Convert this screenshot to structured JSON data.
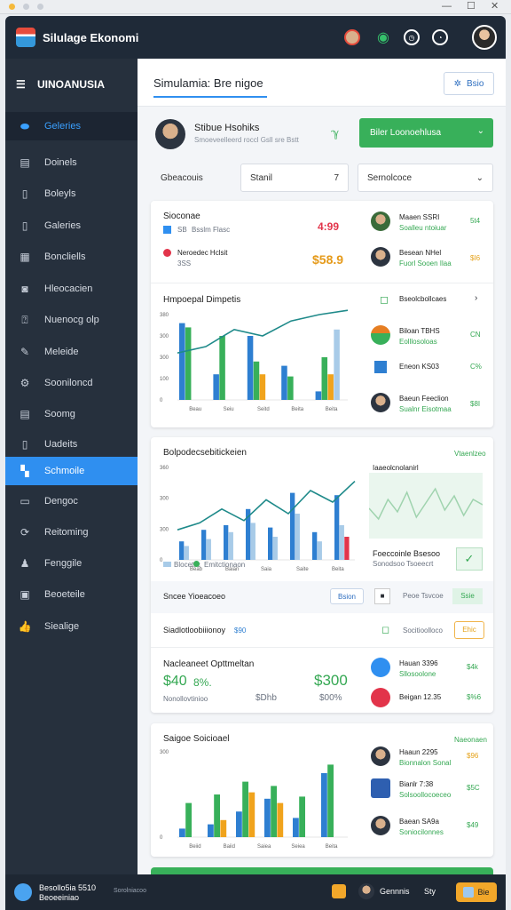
{
  "app": {
    "title": "Silulage Ekonomi"
  },
  "sidebar": {
    "header": "UINOANUSIA",
    "items": [
      {
        "label": "Geleries",
        "icon": "pill-icon"
      },
      {
        "label": "Doinels",
        "icon": "doc-icon"
      },
      {
        "label": "Boleyls",
        "icon": "bookmark-icon"
      },
      {
        "label": "Galeries",
        "icon": "bookmark-icon"
      },
      {
        "label": "Boncliells",
        "icon": "grid-icon"
      },
      {
        "label": "Hleocacien",
        "icon": "camera-icon"
      },
      {
        "label": "Nuenocg olp",
        "icon": "help-icon"
      },
      {
        "label": "Meleide",
        "icon": "pin-icon"
      },
      {
        "label": "Sooniloncd",
        "icon": "settings-icon"
      },
      {
        "label": "Soomg",
        "icon": "sheet-icon"
      },
      {
        "label": "Uadeits",
        "icon": "file-icon"
      },
      {
        "label": "Schmoile",
        "icon": "cart-icon"
      },
      {
        "label": "Dengoc",
        "icon": "window-icon"
      },
      {
        "label": "Reitoming",
        "icon": "refresh-icon"
      },
      {
        "label": "Fenggile",
        "icon": "person-icon"
      },
      {
        "label": "Beoeteile",
        "icon": "wallet-icon"
      },
      {
        "label": "Siealige",
        "icon": "thumbs-up-icon"
      }
    ]
  },
  "main": {
    "title": "Simulamia: Bre nigoe",
    "top_button": "Bsio",
    "profile": {
      "name": "Stibue Hsohiks",
      "subtitle": "Smoeveelleerd roccl Gsll sre Bstt"
    },
    "green_button": "Biler Loonoehlusa",
    "field1": "Gbeacouis",
    "field2": "Stanil",
    "field2_value": "7",
    "field3": "Sernolcoce"
  },
  "card1": {
    "title": "Sioconae",
    "row1_label": "Bsslm Flasc",
    "row1_prefix": "SB",
    "row1_value": "4:99",
    "row2_label": "Neroedec Hclsit",
    "row2_prefix": "3SS",
    "row2_value": "$58.9",
    "chart_title": "Hmpoepal Dimpetis",
    "people": [
      {
        "name": "Maaen SSRI",
        "sub": "Soalleu ntoiuar",
        "value": "5t4",
        "color": "#35a853"
      },
      {
        "name": "Besean NHel",
        "sub": "Fuorl Sooen Ilaa",
        "value": "$I6",
        "color": "#e5a21a"
      }
    ],
    "side_title": "Bseolcbollcaes",
    "side_items": [
      {
        "name": "Biloan TBHS",
        "sub": "Eolllosoloas",
        "value": "CN"
      },
      {
        "name": "Eneon KS03",
        "sub": "",
        "value": "C%"
      },
      {
        "name": "Baeun Feeclion",
        "sub": "Sualnr Eisotmaa",
        "value": "$8I"
      }
    ]
  },
  "card2": {
    "title": "Bolpodecsebitickeien",
    "right_label": "Vtaenlzeo",
    "legend1": "Blocetiic",
    "legend2": "Emitctionaon",
    "side_chart_title": "Iaaeolcnolanirl",
    "caption": "Foeccoinle Bsesoo",
    "caption_sub": "Sonodsoo Tsoeecrt",
    "strip_label": "Sncee Yioeacoeo",
    "strip_btn1": "Bsion",
    "strip_btn2": "Peoe Tsvcoe",
    "strip_btn3": "Ssie",
    "row_title": "Siadlotloobiiionoy",
    "row_tag": "$90",
    "row_side": "Socitioolloco",
    "row_btn": "Ehic",
    "metric_title": "Nacleaneet Opttmeltan",
    "metric_val1": "$40",
    "metric_val1b": "8%.",
    "metric_val2": "$300",
    "metric_sub": "Nonollovtinioo",
    "metric_sub2": "$Dhb",
    "metric_sub3": "$00%",
    "people": [
      {
        "name": "Hauan 3396",
        "sub": "Sllosoolone",
        "value": "$4k",
        "color": "#35a853"
      },
      {
        "name": "Beigan 12.35",
        "sub": "",
        "value": "$%6",
        "color": "#35a853"
      }
    ]
  },
  "card3": {
    "title": "Saigoe Soicioael",
    "right_label": "Naeonaen",
    "people": [
      {
        "name": "Haaun 2295",
        "sub": "Bionnalon Sonal",
        "value": "$96",
        "color": "#e5a21a"
      },
      {
        "name": "Bianlr 7:38",
        "sub": "Solsoollocoeceo",
        "value": "$5C",
        "color": "#35a853"
      },
      {
        "name": "Baean SA9a",
        "sub": "Soniocilonnes",
        "value": "$49",
        "color": "#35a853"
      }
    ]
  },
  "bottom": {
    "line1": "Besollo5ia 5510",
    "line2": "Beoeeiniao",
    "mid_text": "Sorolniacoo",
    "user": "Gennnis",
    "user2": "Sty",
    "btn": "Bie"
  },
  "chart_data": [
    {
      "type": "bar",
      "title": "Hmpoepal Dimpetis",
      "categories": [
        "Beau",
        "Seiu",
        "Seitd",
        "Beita",
        "Beita"
      ],
      "ylim": [
        0,
        400
      ],
      "yticks": [
        0,
        100,
        300,
        300,
        380
      ],
      "series": [
        {
          "color": "#2e7fd1",
          "values": [
            360,
            120,
            300,
            160,
            40
          ]
        },
        {
          "color": "#38b05a",
          "values": [
            340,
            300,
            180,
            110,
            200
          ]
        },
        {
          "color": "#f0a31c",
          "values": [
            0,
            0,
            120,
            0,
            120
          ]
        },
        {
          "color": "#a8cbe8",
          "values": [
            0,
            0,
            0,
            0,
            330
          ]
        }
      ],
      "line": [
        220,
        250,
        330,
        300,
        370,
        400,
        420
      ]
    },
    {
      "type": "bar",
      "title": "Bolpodecsebitickeien",
      "categories": [
        "Beab",
        "Baian",
        "Saia",
        "Saite",
        "Beita"
      ],
      "ylim": [
        0,
        400
      ],
      "yticks": [
        0,
        300,
        300,
        360
      ],
      "series": [
        {
          "color": "#2e7fd1",
          "values": [
            80,
            130,
            150,
            220,
            140,
            290,
            120,
            280
          ]
        },
        {
          "color": "#a8cbe8",
          "values": [
            60,
            90,
            120,
            160,
            100,
            200,
            80,
            150
          ]
        },
        {
          "color": "#e2344a",
          "values": [
            0,
            0,
            0,
            0,
            0,
            0,
            0,
            100
          ]
        }
      ],
      "line": [
        130,
        160,
        220,
        170,
        260,
        200,
        300,
        250,
        340
      ]
    },
    {
      "type": "bar",
      "title": "Saigoe Soicioael",
      "categories": [
        "Beiid",
        "Baiid",
        "Saiea",
        "Seiea",
        "Beita"
      ],
      "ylim": [
        0,
        400
      ],
      "yticks": [
        0,
        300
      ],
      "series": [
        {
          "color": "#2e7fd1",
          "values": [
            40,
            60,
            120,
            180,
            90,
            300
          ]
        },
        {
          "color": "#38b05a",
          "values": [
            160,
            200,
            260,
            240,
            190,
            340
          ]
        },
        {
          "color": "#f0a31c",
          "values": [
            0,
            80,
            210,
            160,
            0,
            0
          ]
        }
      ]
    }
  ]
}
